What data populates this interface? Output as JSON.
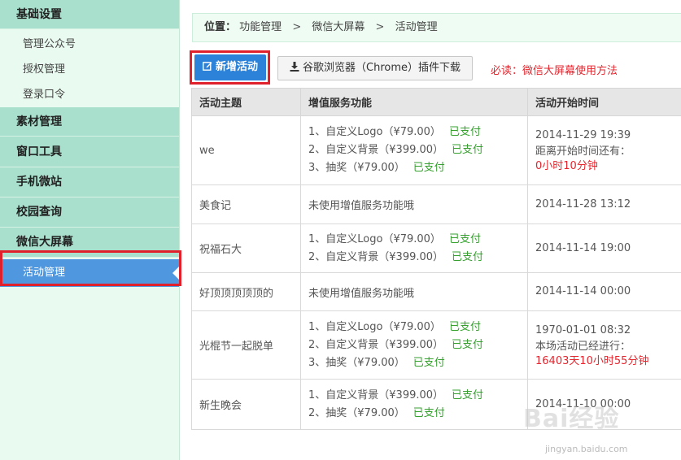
{
  "sidebar": {
    "sections": [
      {
        "title": "基础设置",
        "items": [
          "管理公众号",
          "授权管理",
          "登录口令"
        ]
      },
      {
        "title": "素材管理",
        "items": []
      },
      {
        "title": "窗口工具",
        "items": []
      },
      {
        "title": "手机微站",
        "items": []
      },
      {
        "title": "校园查询",
        "items": []
      },
      {
        "title": "微信大屏幕",
        "items": [
          "活动管理"
        ]
      }
    ]
  },
  "breadcrumb": {
    "label": "位置：",
    "crumbs": [
      "功能管理",
      "微信大屏幕",
      "活动管理"
    ],
    "separator": ">"
  },
  "toolbar": {
    "new_activity": "新增活动",
    "chrome_plugin": "谷歌浏览器（Chrome）插件下载",
    "must_read": "必读：微信大屏幕使用方法"
  },
  "table": {
    "headers": [
      "活动主题",
      "增值服务功能",
      "活动开始时间"
    ],
    "rows": [
      {
        "topic": "we",
        "services": [
          {
            "text": "1、自定义Logo（¥79.00）",
            "status": "已支付"
          },
          {
            "text": "2、自定义背景（¥399.00）",
            "status": "已支付"
          },
          {
            "text": "3、抽奖（¥79.00）",
            "status": "已支付"
          }
        ],
        "time": "2014-11-29 19:39",
        "note": "距离开始时间还有：",
        "countdown": "0小时10分钟"
      },
      {
        "topic": "美食记",
        "none_text": "未使用增值服务功能哦",
        "time": "2014-11-28 13:12"
      },
      {
        "topic": "祝福石大",
        "services": [
          {
            "text": "1、自定义Logo（¥79.00）",
            "status": "已支付"
          },
          {
            "text": "2、自定义背景（¥399.00）",
            "status": "已支付"
          }
        ],
        "time": "2014-11-14 19:00"
      },
      {
        "topic": "好顶顶顶顶顶的",
        "none_text": "未使用增值服务功能哦",
        "time": "2014-11-14 00:00"
      },
      {
        "topic": "光棍节一起脱单",
        "services": [
          {
            "text": "1、自定义Logo（¥79.00）",
            "status": "已支付"
          },
          {
            "text": "2、自定义背景（¥399.00）",
            "status": "已支付"
          },
          {
            "text": "3、抽奖（¥79.00）",
            "status": "已支付"
          }
        ],
        "time": "1970-01-01 08:32",
        "note": "本场活动已经进行：",
        "countdown": "16403天10小时55分钟"
      },
      {
        "topic": "新生晚会",
        "services": [
          {
            "text": "1、自定义背景（¥399.00）",
            "status": "已支付"
          },
          {
            "text": "2、抽奖（¥79.00）",
            "status": "已支付"
          }
        ],
        "time": "2014-11-10 00:00"
      }
    ]
  },
  "watermark": {
    "brand": "Bai经验",
    "url": "jingyan.baidu.com"
  },
  "colors": {
    "sidebar_bg": "#e9faf0",
    "section_bg": "#a8e0cd",
    "active_bg": "#4f97de",
    "primary_button": "#2b82d8",
    "paid_green": "#36a12f",
    "alert_red": "#e4262e",
    "highlight_box": "#e0212b"
  },
  "icons": {
    "new_activity": "edit-icon",
    "chrome_plugin": "download-icon",
    "active_item": "caret-left-icon"
  }
}
